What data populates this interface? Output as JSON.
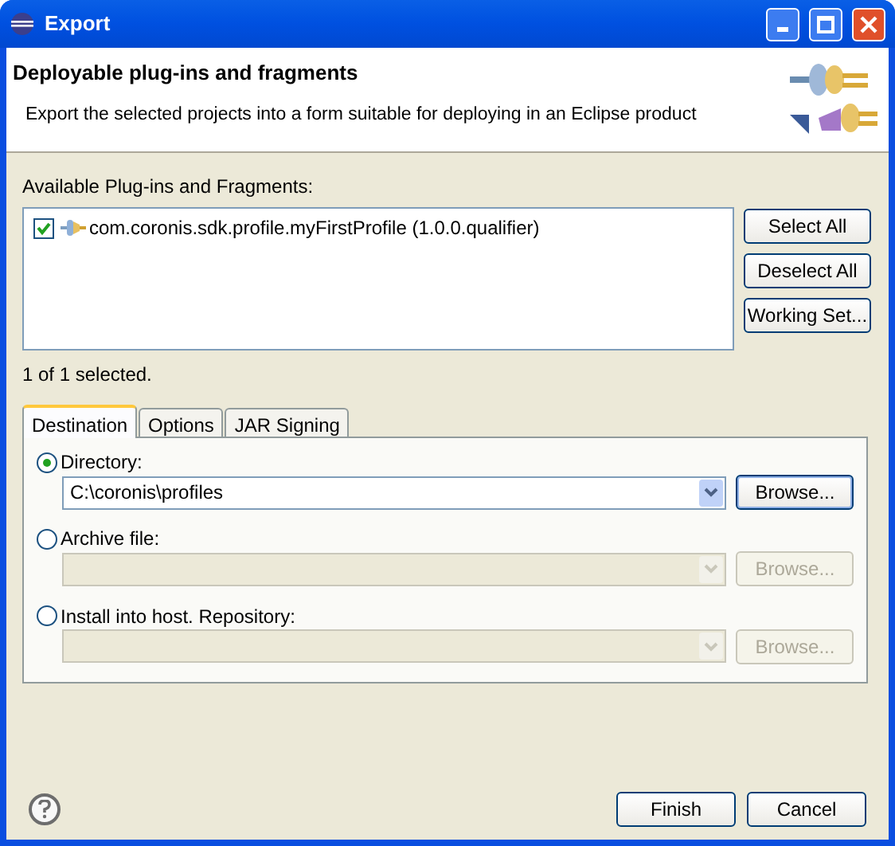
{
  "window": {
    "title": "Export"
  },
  "header": {
    "title": "Deployable plug-ins and fragments",
    "description": "Export the selected projects into a form suitable for deploying in an Eclipse product"
  },
  "plugins": {
    "label": "Available Plug-ins and Fragments:",
    "items": [
      {
        "label": "com.coronis.sdk.profile.myFirstProfile (1.0.0.qualifier)",
        "checked": true
      }
    ],
    "buttons": [
      "Select All",
      "Deselect All",
      "Working Set..."
    ]
  },
  "selection_status": "1 of 1 selected.",
  "tabs": [
    {
      "label": "Destination",
      "selected": true
    },
    {
      "label": "Options",
      "selected": false
    },
    {
      "label": "JAR Signing",
      "selected": false
    }
  ],
  "destinations": [
    {
      "label": "Directory:",
      "selected": true,
      "value": "C:\\coronis\\profiles",
      "disabled": false,
      "button": "Browse...",
      "focused": true
    },
    {
      "label": "Archive file:",
      "selected": false,
      "disabled": true,
      "button": "Browse...",
      "focused": false
    },
    {
      "label": "Install into host. Repository:",
      "selected": false,
      "disabled": true,
      "button": "Browse...",
      "focused": false
    }
  ],
  "footer": {
    "buttons": [
      "Finish",
      "Cancel"
    ]
  }
}
